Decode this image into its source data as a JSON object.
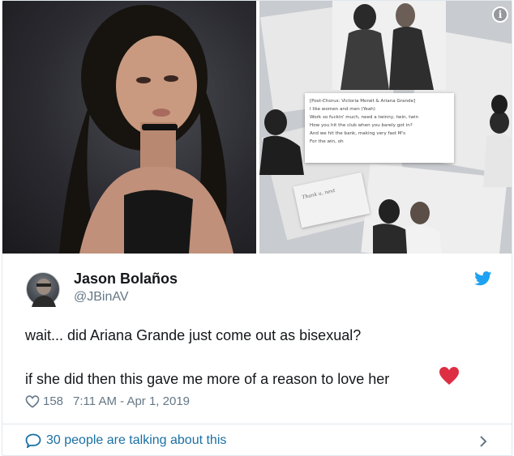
{
  "media": {
    "info_glyph": "i",
    "lyrics": [
      "[Post-Chorus: Victoria Monét & Ariana Grande]",
      "I like women and men (Yeah)",
      "Work so fuckin' much, need a twinny, twin, twin",
      "How you hit the club when you barely got in?",
      "And we hit the bank, making very fast M's",
      "For the win, oh"
    ],
    "note": "Thank u, next"
  },
  "author": {
    "display_name": "Jason Bolaños",
    "handle": "@JBinAV"
  },
  "tweet": {
    "line1": "wait... did Ariana Grande just come out as bisexual?",
    "line2": "if she did then this gave me more of a reason to love her"
  },
  "meta": {
    "like_count": "158",
    "timestamp": "7:11 AM - Apr 1, 2019"
  },
  "footer": {
    "talking_text": "30 people are talking about this"
  },
  "colors": {
    "link_blue": "#1b6fa3",
    "twitter_blue": "#1da1f2",
    "heart_red": "#dd2e44",
    "muted_gray": "#657786"
  }
}
